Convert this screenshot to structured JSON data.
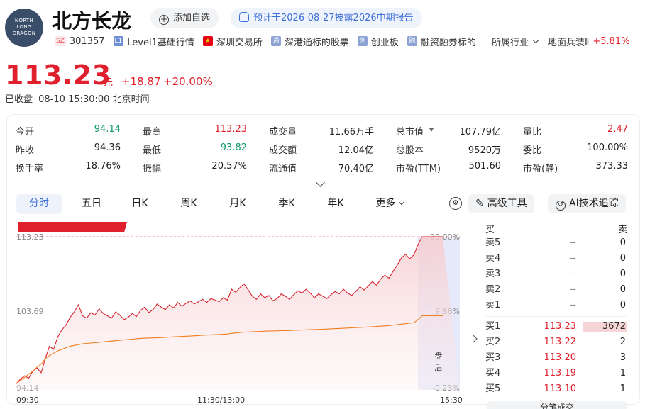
{
  "header": {
    "logo_lines": [
      "NORTH",
      "LONG",
      "DRAGON"
    ],
    "name": "北方长龙",
    "add_watch": "添加自选",
    "forecast": "预计于2026-08-27披露2026中期报告"
  },
  "tags": {
    "market_badge": "SZ",
    "code": "301357",
    "level1_badge": "L1",
    "level1": "Level1基础行情",
    "exchange": "深圳交易所",
    "hk_connect_badge": "通",
    "hk_connect": "深港通标的股票",
    "gem_badge": "创",
    "gem": "创业板",
    "margin_badge": "融",
    "margin": "融资融券标的",
    "industry": "所属行业",
    "sector": "地面兵装Ⅱ",
    "sector_change": "+5.81%"
  },
  "quote": {
    "price": "113.23",
    "unit": "元",
    "change": "+18.87",
    "change_pct": "+20.00%",
    "status": "已收盘",
    "time": "08-10 15:30:00 北京时间",
    "up_color": "#e0212d",
    "down_color": "#10976a"
  },
  "stats": [
    [
      {
        "label": "今开",
        "value": "94.14",
        "tone": "down"
      },
      {
        "label": "最高",
        "value": "113.23",
        "tone": "up"
      },
      {
        "label": "成交量",
        "value": "11.66万手"
      },
      {
        "label": "总市值",
        "value": "107.79亿"
      },
      {
        "label": "量比",
        "value": "2.47",
        "tone": "up"
      }
    ],
    [
      {
        "label": "昨收",
        "value": "94.36"
      },
      {
        "label": "最低",
        "value": "93.82",
        "tone": "down"
      },
      {
        "label": "成交额",
        "value": "12.04亿"
      },
      {
        "label": "总股本",
        "value": "9520万"
      },
      {
        "label": "委比",
        "value": "100.00%"
      }
    ],
    [
      {
        "label": "换手率",
        "value": "18.76%"
      },
      {
        "label": "振幅",
        "value": "20.57%"
      },
      {
        "label": "流通值",
        "value": "70.40亿"
      },
      {
        "label": "市盈(TTM)",
        "value": "501.60"
      },
      {
        "label": "市盈(静)",
        "value": "373.33"
      }
    ]
  ],
  "tabs": [
    "分时",
    "五日",
    "日K",
    "周K",
    "月K",
    "季K",
    "年K",
    "更多"
  ],
  "tools": {
    "advanced": "高级工具",
    "ai": "AI技术追踪"
  },
  "chart_data": {
    "type": "line",
    "y_labels": [
      "113.23",
      "103.69",
      "94.14"
    ],
    "pct_labels": [
      "20.00%",
      "9.88%",
      "-0.23%"
    ],
    "x_labels": [
      "09:30",
      "11:30/13:00",
      "15:30"
    ],
    "after_hours": "盘后",
    "series": [
      {
        "color": "#d6222e",
        "values": [
          94.4,
          95.0,
          95.4,
          95.1,
          96.0,
          96.4,
          95.8,
          97.6,
          99.2,
          98.8,
          100.4,
          101.3,
          101.9,
          102.9,
          103.6,
          104.5,
          103.1,
          102.8,
          103.5,
          103.2,
          104.0,
          103.4,
          103.1,
          102.8,
          103.6,
          103.2,
          102.6,
          102.9,
          103.4,
          103.0,
          103.8,
          104.2,
          103.5,
          103.9,
          104.6,
          104.2,
          103.9,
          104.5,
          104.1,
          104.8,
          104.3,
          104.7,
          105.0,
          104.6,
          104.9,
          105.2,
          104.8,
          105.3,
          105.1,
          104.9,
          105.4,
          105.1,
          106.5,
          106.1,
          106.7,
          107.2,
          106.4,
          105.6,
          105.2,
          105.9,
          105.4,
          105.7,
          105.0,
          105.3,
          105.9,
          105.6,
          105.2,
          105.8,
          106.3,
          106.0,
          106.5,
          106.0,
          105.4,
          105.9,
          105.6,
          105.3,
          105.8,
          106.2,
          105.9,
          106.5,
          106.0,
          105.7,
          106.2,
          106.8,
          106.4,
          106.9,
          107.5,
          107.0,
          107.8,
          108.3,
          107.9,
          108.8,
          109.6,
          110.5,
          111.0,
          110.4,
          110.9,
          112.2,
          113.23,
          113.23,
          113.23,
          113.23,
          113.23,
          113.23
        ]
      },
      {
        "color": "#ef7d21",
        "values": [
          94.4,
          94.8,
          95.2,
          95.6,
          96.0,
          96.5,
          96.9,
          97.6,
          98.0,
          98.3,
          98.6,
          98.8,
          99.0,
          99.2,
          99.3,
          99.4,
          99.5,
          99.55,
          99.6,
          99.65,
          99.7,
          99.75,
          99.8,
          99.85,
          99.9,
          99.95,
          100.0,
          100.05,
          100.1,
          100.15,
          100.2,
          100.22,
          100.24,
          100.26,
          100.28,
          100.3,
          100.33,
          100.36,
          100.4,
          100.42,
          100.45,
          100.48,
          100.5,
          100.53,
          100.56,
          100.6,
          100.62,
          100.65,
          100.68,
          100.7,
          100.72,
          100.76,
          100.85,
          100.9,
          100.95,
          101.0,
          101.02,
          101.05,
          101.07,
          101.1,
          101.12,
          101.14,
          101.15,
          101.17,
          101.19,
          101.2,
          101.21,
          101.23,
          101.25,
          101.27,
          101.3,
          101.32,
          101.33,
          101.35,
          101.37,
          101.4,
          101.42,
          101.45,
          101.47,
          101.5,
          101.52,
          101.55,
          101.58,
          101.6,
          101.63,
          101.66,
          101.7,
          101.73,
          101.76,
          101.8,
          101.84,
          101.9,
          101.96,
          102.02,
          102.08,
          102.15,
          102.2,
          102.6,
          103.1,
          103.1,
          103.1,
          103.1,
          103.1,
          103.1
        ]
      }
    ],
    "ylim": [
      93.6,
      114.5
    ],
    "prev_close": "94.36"
  },
  "order_book": {
    "buy_label": "买",
    "sell_label": "卖",
    "buy_ratio": 1.0,
    "asks": [
      {
        "name": "卖5",
        "price": "--",
        "vol": "0"
      },
      {
        "name": "卖4",
        "price": "--",
        "vol": "0"
      },
      {
        "name": "卖3",
        "price": "--",
        "vol": "0"
      },
      {
        "name": "卖2",
        "price": "--",
        "vol": "0"
      },
      {
        "name": "卖1",
        "price": "--",
        "vol": "0"
      }
    ],
    "bids": [
      {
        "name": "买1",
        "price": "113.23",
        "vol": "3672"
      },
      {
        "name": "买2",
        "price": "113.22",
        "vol": "2"
      },
      {
        "name": "买3",
        "price": "113.20",
        "vol": "3"
      },
      {
        "name": "买4",
        "price": "113.19",
        "vol": "1"
      },
      {
        "name": "买5",
        "price": "113.10",
        "vol": "1"
      }
    ],
    "trades_label": "分笔成交"
  }
}
